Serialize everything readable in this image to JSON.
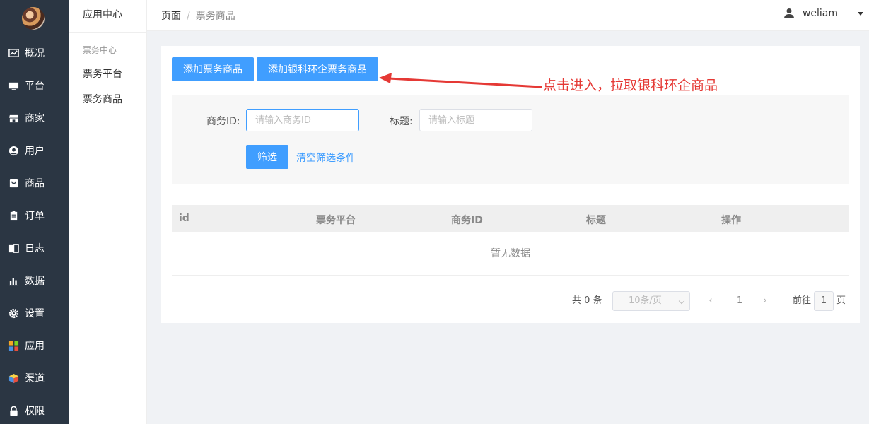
{
  "sidebar": {
    "items": [
      {
        "label": "概况",
        "icon": "chart-icon"
      },
      {
        "label": "平台",
        "icon": "monitor-icon"
      },
      {
        "label": "商家",
        "icon": "store-icon"
      },
      {
        "label": "用户",
        "icon": "user-icon"
      },
      {
        "label": "商品",
        "icon": "bag-icon"
      },
      {
        "label": "订单",
        "icon": "clipboard-icon"
      },
      {
        "label": "日志",
        "icon": "book-icon"
      },
      {
        "label": "数据",
        "icon": "bar-chart-icon"
      },
      {
        "label": "设置",
        "icon": "gear-icon"
      },
      {
        "label": "应用",
        "icon": "apps-icon"
      },
      {
        "label": "渠道",
        "icon": "cube-icon"
      },
      {
        "label": "权限",
        "icon": "lock-icon"
      }
    ]
  },
  "subbar": {
    "title": "应用中心",
    "group": "票务中心",
    "items": [
      "票务平台",
      "票务商品"
    ]
  },
  "header": {
    "breadcrumb": [
      "页面",
      "票务商品"
    ],
    "username": "weliam"
  },
  "toolbar": {
    "add_ticket_label": "添加票务商品",
    "add_bank_ticket_label": "添加银科环企票务商品"
  },
  "filter": {
    "business_id_label": "商务ID:",
    "business_id_placeholder": "请输入商务ID",
    "title_label": "标题:",
    "title_placeholder": "请输入标题",
    "filter_button": "筛选",
    "clear_link": "清空筛选条件"
  },
  "table": {
    "columns": [
      "id",
      "票务平台",
      "商务ID",
      "标题",
      "操作"
    ],
    "empty_text": "暂无数据"
  },
  "pagination": {
    "total": "共 0 条",
    "page_size": "10条/页",
    "current_page": "1",
    "goto_label": "前往",
    "goto_value": "1",
    "page_suffix": "页"
  },
  "annotation": {
    "text": "点击进入，拉取银科环企商品",
    "color": "#e53935"
  },
  "colors": {
    "primary": "#409eff",
    "sidebar_bg": "#2b3643"
  }
}
